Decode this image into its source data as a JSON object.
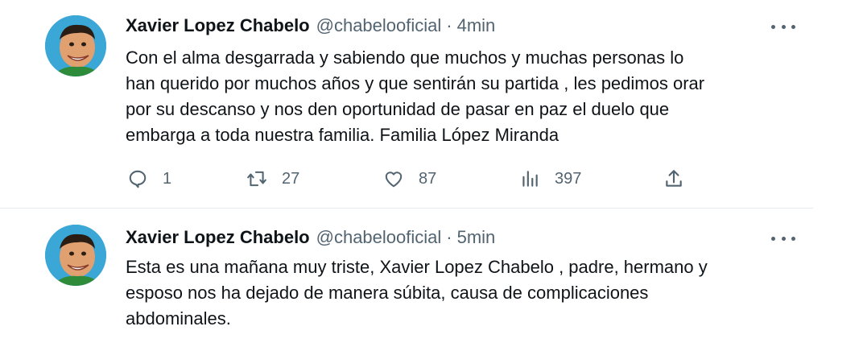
{
  "tweets": [
    {
      "author_name": "Xavier Lopez Chabelo",
      "handle": "@chabelooficial",
      "separator": "·",
      "time": "4min",
      "text_lines": [
        "Con el alma desgarrada y sabiendo que muchos y muchas personas lo",
        "han querido por muchos años y que sentirán su partida , les pedimos orar",
        "por su descanso  y nos den oportunidad de pasar en paz  el duelo que",
        "embarga a toda nuestra familia.  Familia López Miranda"
      ],
      "actions": {
        "replies": "1",
        "retweets": "27",
        "likes": "87",
        "views": "397"
      }
    },
    {
      "author_name": "Xavier Lopez Chabelo",
      "handle": "@chabelooficial",
      "separator": "·",
      "time": "5min",
      "text_lines": [
        "Esta es una mañana muy triste,  Xavier Lopez Chabelo , padre, hermano y",
        "esposo nos ha dejado de manera súbita, causa de complicaciones",
        "abdominales."
      ]
    }
  ],
  "icons": {
    "reply": "reply-icon",
    "retweet": "retweet-icon",
    "like": "heart-icon",
    "views": "views-icon",
    "share": "share-icon",
    "more": "more-icon"
  },
  "colors": {
    "text": "#0f1419",
    "secondary": "#536471",
    "divider": "#e6ecf0",
    "avatar_bg": "#3aa7d6"
  }
}
